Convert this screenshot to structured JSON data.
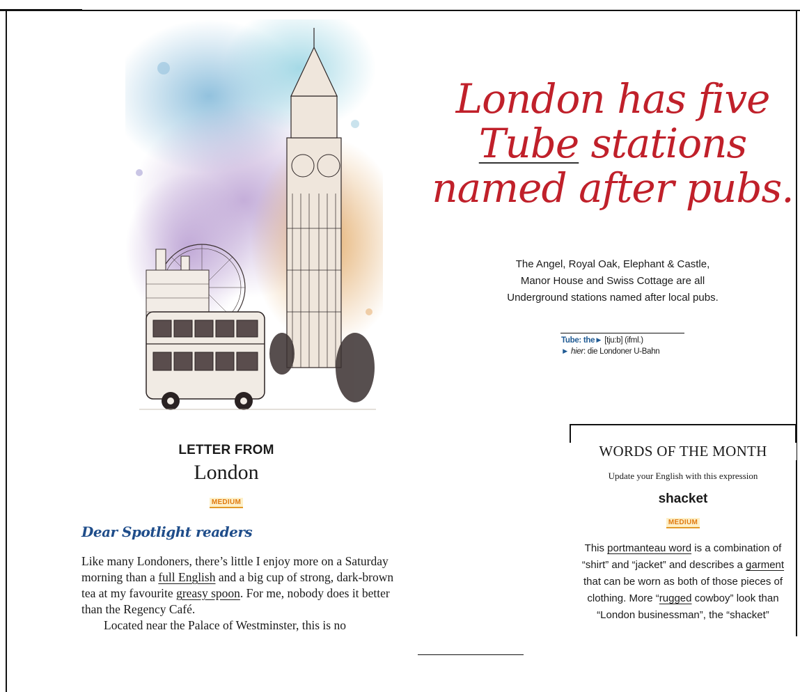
{
  "headline": {
    "line1": "London has five",
    "tube": "Tube",
    "line2_rest": " stations",
    "line3": "named after pubs."
  },
  "fact": {
    "line1": "The Angel, Royal Oak, Elephant & Castle,",
    "line2": "Manor House and Swiss Cottage are all",
    "line3": "Underground stations named after local pubs."
  },
  "gloss": {
    "term": "Tube: the",
    "pron": " [tju:b] (ifml.)",
    "hier": "hier",
    "meaning": ": die Londoner U-Bahn"
  },
  "letter": {
    "title": "LETTER FROM",
    "city": "London",
    "level": "MEDIUM",
    "greeting": "Dear Spotlight readers",
    "p1_a": "Like many Londoners, there’s little I enjoy more on a Saturday morning than a ",
    "p1_full_english": "full English",
    "p1_b": " and a big cup of strong, dark-brown tea at my favourite ",
    "p1_greasy_spoon": "greasy spoon",
    "p1_c": ". For me, nobody does it better than the Regency Café.",
    "p2": "Located near the Palace of Westminster, this is no"
  },
  "words_of_month": {
    "title": "WORDS OF THE MONTH",
    "subtitle": "Update your English with this expression",
    "word": "shacket",
    "level": "MEDIUM",
    "t1": "This ",
    "portmanteau": "portmanteau word",
    "t2": " is a combi­nation of “shirt” and “jacket” and de­scribes a ",
    "garment": "garment",
    "t3": " that can be worn as both of those pieces of clothing. More “",
    "rugged": "rugged",
    "t4": " cowboy” look than “London businessman”, the “shacket”"
  },
  "colors": {
    "headline": "#c0202a",
    "accent_blue": "#1f4d8a",
    "badge_text": "#e07a10",
    "badge_bg": "#fdf0c8"
  }
}
